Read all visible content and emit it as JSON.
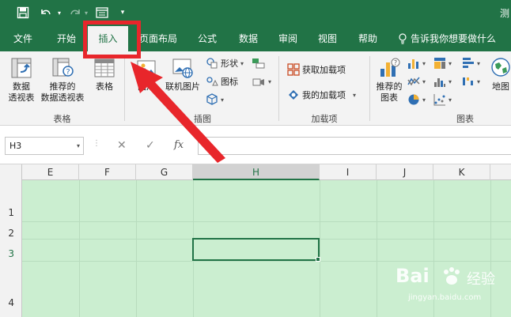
{
  "title_bar": {
    "title": "测"
  },
  "tabs": [
    {
      "label": "文件"
    },
    {
      "label": "开始"
    },
    {
      "label": "插入"
    },
    {
      "label": "页面布局"
    },
    {
      "label": "公式"
    },
    {
      "label": "数据"
    },
    {
      "label": "审阅"
    },
    {
      "label": "视图"
    },
    {
      "label": "帮助"
    }
  ],
  "active_tab": "插入",
  "tell_me": "告诉我你想要做什么",
  "ribbon": {
    "tables": {
      "group_label": "表格",
      "pivot_line1": "数据",
      "pivot_line2": "透视表",
      "recommended_pivot_line1": "推荐的",
      "recommended_pivot_line2": "数据透视表",
      "table": "表格"
    },
    "illustrations": {
      "group_label": "插图",
      "pictures": "图片",
      "online_pictures": "联机图片",
      "shapes": "形状",
      "icons": "图标"
    },
    "addins": {
      "group_label": "加载项",
      "get_addins": "获取加载项",
      "my_addins": "我的加载项"
    },
    "charts": {
      "group_label": "图表",
      "recommended_line1": "推荐的",
      "recommended_line2": "图表",
      "maps": "地图"
    }
  },
  "formula_bar": {
    "name_box": "H3",
    "cancel": "✕",
    "enter": "✓",
    "fx": "fx"
  },
  "columns": [
    "E",
    "F",
    "G",
    "H",
    "I",
    "J",
    "K"
  ],
  "rows": [
    "1",
    "2",
    "3",
    "4"
  ],
  "selected_cell": {
    "column": "H",
    "row": "3"
  },
  "watermark": {
    "brand": "Bai",
    "brand2": "经验",
    "url": "jingyan.baidu.com"
  },
  "colors": {
    "excel_green": "#217346",
    "highlight_red": "#e8262b",
    "grid_fill": "#cbeed0"
  }
}
